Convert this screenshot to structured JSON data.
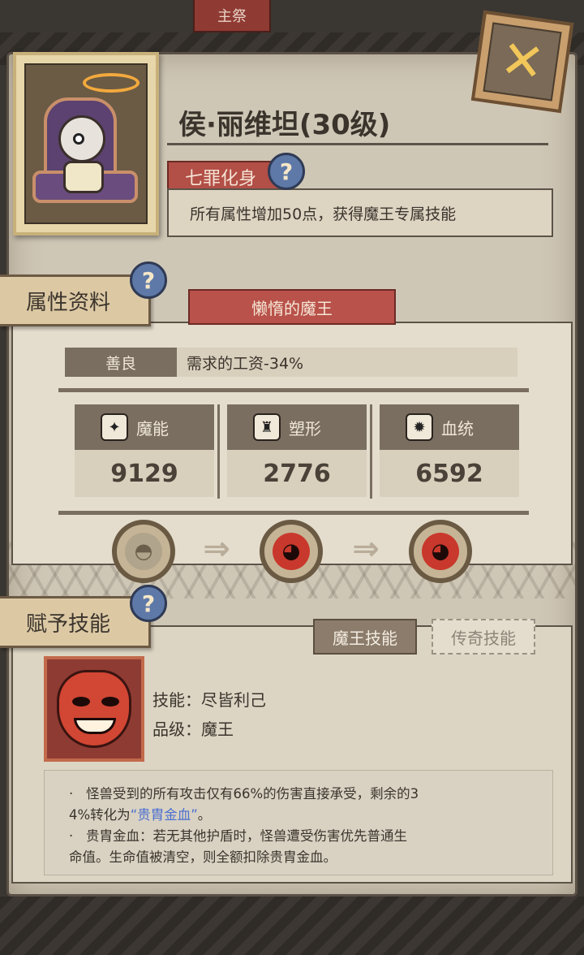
{
  "top_tab": {
    "label": "主祭"
  },
  "character": {
    "name": "侯·丽维坦(30级)",
    "trait_label": "七罪化身",
    "trait_desc": "所有属性增加50点，获得魔王专属技能"
  },
  "help_icon_glyph": "?",
  "close_icon_glyph": "✕",
  "attributes": {
    "section_label": "属性资料",
    "title": "懒惰的魔王",
    "alignment": {
      "label": "善良",
      "effect": "需求的工资-34%"
    },
    "stats": [
      {
        "name": "魔能",
        "value": "9129",
        "icon": "flame-claw-icon"
      },
      {
        "name": "塑形",
        "value": "2776",
        "icon": "body-armor-icon"
      },
      {
        "name": "血统",
        "value": "6592",
        "icon": "gear-sun-icon"
      }
    ],
    "evolution_arrows": [
      "⇒",
      "⇒"
    ]
  },
  "skills": {
    "section_label": "赋予技能",
    "tabs": [
      {
        "label": "魔王技能",
        "active": true
      },
      {
        "label": "传奇技能",
        "active": false
      }
    ],
    "skill_name_line": "技能：尽皆利己",
    "skill_grade_line": "品级：魔王",
    "desc_bullet": "·",
    "desc_1_a": "怪兽受到的所有攻击仅有66%的伤害直接承受，剩余的3",
    "desc_1_b_prefix": "4%转化为",
    "desc_1_b_highlight": "“贵胄金血”",
    "desc_1_b_suffix": "。",
    "desc_2_a": "贵胄金血：若无其他护盾时，怪兽遭受伤害优先普通生",
    "desc_2_b": "命值。生命值被清空，则全额扣除贵胄金血。"
  },
  "colors": {
    "accent_red": "#b8524a",
    "parchment": "#cfc7b6",
    "highlight_blue": "#4b6fd0",
    "help_blue": "#5e79a8"
  }
}
